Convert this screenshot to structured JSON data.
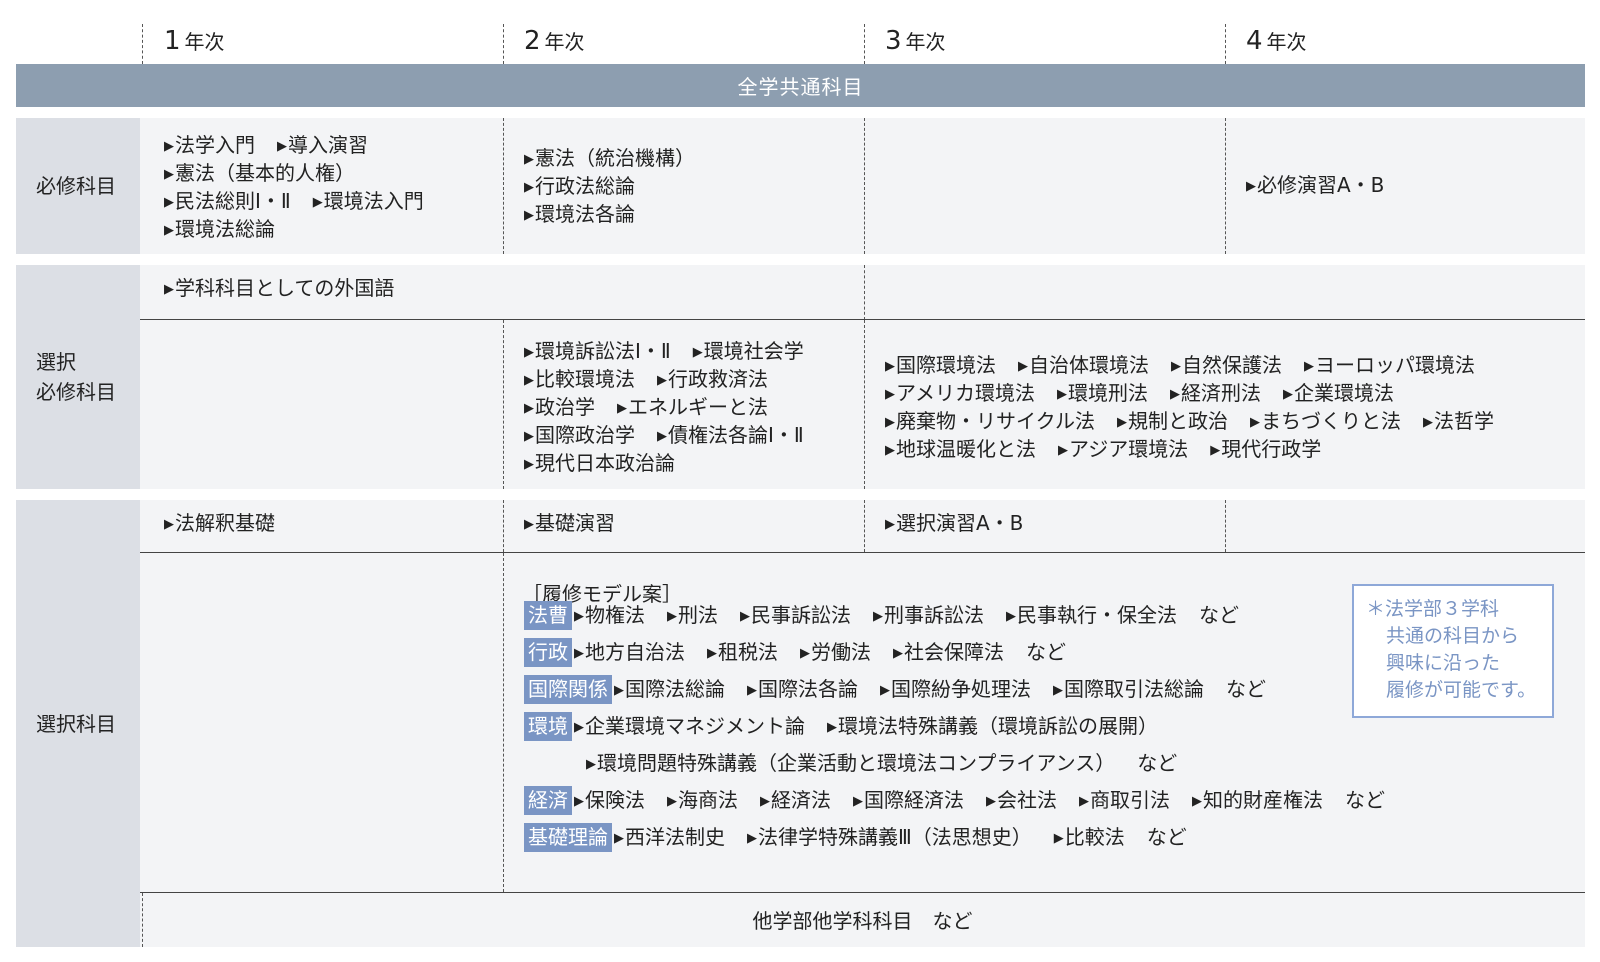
{
  "years": [
    {
      "num": "1",
      "label": "年次"
    },
    {
      "num": "2",
      "label": "年次"
    },
    {
      "num": "3",
      "label": "年次"
    },
    {
      "num": "4",
      "label": "年次"
    }
  ],
  "common_bar": "全学共通科目",
  "rows": {
    "required": {
      "label": "必修科目",
      "y1": [
        [
          "法学入門",
          "導入演習"
        ],
        [
          "憲法（基本的人権）"
        ],
        [
          "民法総則Ⅰ・Ⅱ",
          "環境法入門"
        ],
        [
          "環境法総論"
        ]
      ],
      "y2": [
        [
          "憲法（統治機構）"
        ],
        [
          "行政法総論"
        ],
        [
          "環境法各論"
        ]
      ],
      "y4": [
        [
          "必修演習A・B"
        ]
      ]
    },
    "elective_required": {
      "label_line1": "選択",
      "label_line2": "必修科目",
      "foreign": [
        [
          "学科科目としての外国語"
        ]
      ],
      "y2": [
        [
          "環境訴訟法Ⅰ・Ⅱ",
          "環境社会学"
        ],
        [
          "比較環境法",
          "行政救済法"
        ],
        [
          "政治学",
          "エネルギーと法"
        ],
        [
          "国際政治学",
          "債権法各論Ⅰ・Ⅱ"
        ],
        [
          "現代日本政治論"
        ]
      ],
      "y34": [
        [
          "国際環境法",
          "自治体環境法",
          "自然保護法",
          "ヨーロッパ環境法"
        ],
        [
          "アメリカ環境法",
          "環境刑法",
          "経済刑法",
          "企業環境法"
        ],
        [
          "廃棄物・リサイクル法",
          "規制と政治",
          "まちづくりと法",
          "法哲学"
        ],
        [
          "地球温暖化と法",
          "アジア環境法",
          "現代行政学"
        ]
      ]
    },
    "elective": {
      "label": "選択科目",
      "y1": [
        [
          "法解釈基礎"
        ]
      ],
      "y2": [
        [
          "基礎演習"
        ]
      ],
      "y3": [
        [
          "選択演習A・B"
        ]
      ],
      "model_title": "［履修モデル案］",
      "model": [
        {
          "tag": "法曹",
          "items": [
            "物権法",
            "刑法",
            "民事訴訟法",
            "刑事訴訟法",
            "民事執行・保全法"
          ],
          "suffix": "など"
        },
        {
          "tag": "行政",
          "items": [
            "地方自治法",
            "租税法",
            "労働法",
            "社会保障法"
          ],
          "suffix": "など"
        },
        {
          "tag": "国際関係",
          "items": [
            "国際法総論",
            "国際法各論",
            "国際紛争処理法",
            "国際取引法総論"
          ],
          "suffix": "など"
        },
        {
          "tag": "環境",
          "items": [
            "企業環境マネジメント論",
            "環境法特殊講義（環境訴訟の展開）"
          ],
          "suffix": ""
        },
        {
          "tag": "",
          "items": [
            "環境問題特殊講義（企業活動と環境法コンプライアンス）"
          ],
          "suffix": "など"
        },
        {
          "tag": "経済",
          "items": [
            "保険法",
            "海商法",
            "経済法",
            "国際経済法",
            "会社法",
            "商取引法",
            "知的財産権法"
          ],
          "suffix": "など"
        },
        {
          "tag": "基礎理論",
          "items": [
            "西洋法制史",
            "法律学特殊講義Ⅲ（法思想史）",
            "比較法"
          ],
          "suffix": "など"
        }
      ],
      "note": [
        "＊法学部３学科",
        "共通の科目から",
        "興味に沿った",
        "履修が可能です。"
      ],
      "other": "他学部他学科科目　など"
    }
  },
  "colors": {
    "header_bar": "#8d9eb0",
    "label_bg": "#dcdfe5",
    "area_bg": "#f3f4f6",
    "tag_bg": "#7a95c4",
    "note_border": "#8ea8d8"
  }
}
